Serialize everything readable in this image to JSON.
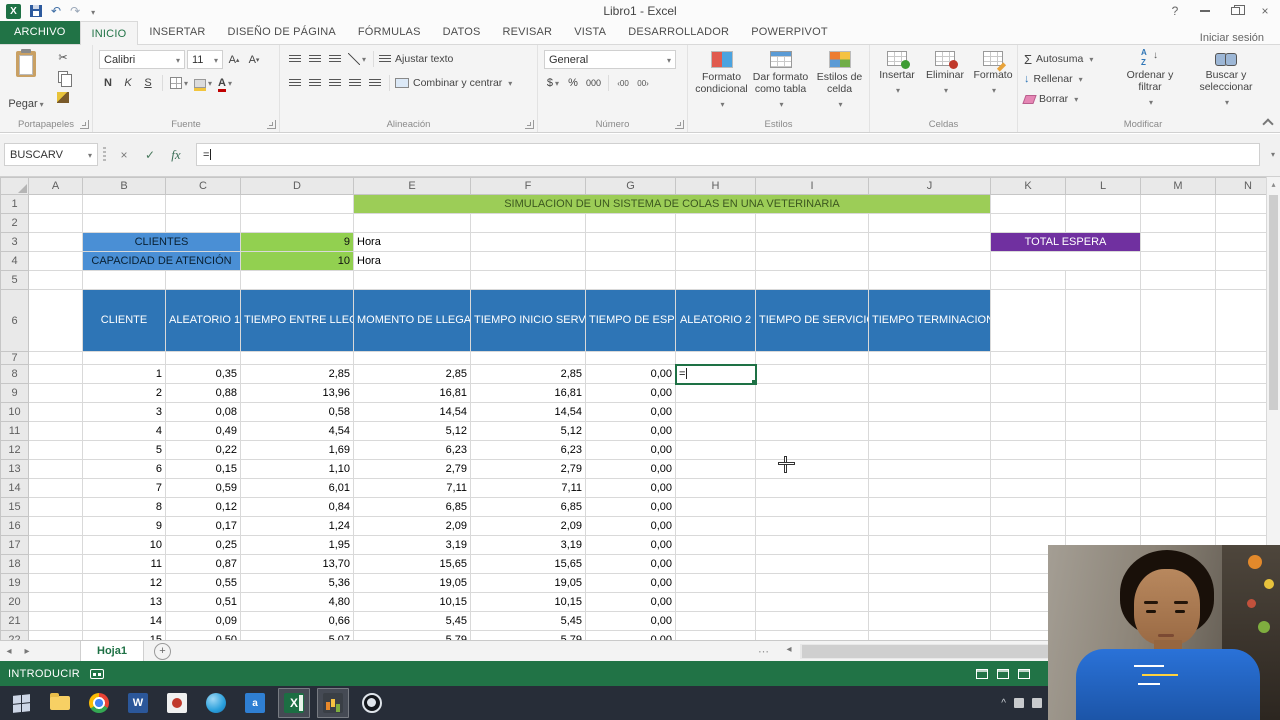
{
  "window": {
    "title": "Libro1 - Excel",
    "sign_in": "Iniciar sesión"
  },
  "icons": {
    "excel_logo_letter": "X",
    "undo": "↶",
    "redo": "↷",
    "help": "?",
    "close": "×",
    "check": "✓",
    "scissors": "✂",
    "letter_a": "A",
    "nav_left": "◂",
    "nav_right": "▸",
    "up": "▴",
    "down": "▾",
    "ellipsis": "⋯",
    "plus": "+",
    "fill_down_arrow": "↓",
    "sort_arrow": "↓",
    "word_letter": "W",
    "translator_letter": "a",
    "excel_letter": "X"
  },
  "ribbon_tabs": [
    {
      "label": "ARCHIVO"
    },
    {
      "label": "INICIO"
    },
    {
      "label": "INSERTAR"
    },
    {
      "label": "DISEÑO DE PÁGINA"
    },
    {
      "label": "FÓRMULAS"
    },
    {
      "label": "DATOS"
    },
    {
      "label": "REVISAR"
    },
    {
      "label": "VISTA"
    },
    {
      "label": "DESARROLLADOR"
    },
    {
      "label": "POWERPIVOT"
    }
  ],
  "ribbon": {
    "clipboard": {
      "group": "Portapapeles",
      "paste": "Pegar"
    },
    "font": {
      "group": "Fuente",
      "family": "Calibri",
      "size": "11",
      "bold": "N",
      "italic": "K",
      "underline": "S"
    },
    "alignment": {
      "group": "Alineación",
      "wrap": "Ajustar texto",
      "merge": "Combinar y centrar"
    },
    "number": {
      "group": "Número",
      "format": "General",
      "currency": "$",
      "percent": "%",
      "thousands": "000"
    },
    "styles": {
      "group": "Estilos",
      "conditional": "Formato condicional",
      "as_table": "Dar formato como tabla",
      "cell_styles": "Estilos de celda"
    },
    "cells": {
      "group": "Celdas",
      "insert": "Insertar",
      "delete": "Eliminar",
      "format": "Formato"
    },
    "editing": {
      "group": "Modificar",
      "autosum_symbol": "Σ",
      "autosum": "Autosuma",
      "fill": "Rellenar",
      "clear": "Borrar",
      "sort": "Ordenar y filtrar",
      "find": "Buscar y seleccionar"
    }
  },
  "formula_bar": {
    "name_box": "BUSCARV",
    "fx": "fx",
    "formula": "="
  },
  "sheet": {
    "columns": [
      "A",
      "B",
      "C",
      "D",
      "E",
      "F",
      "G",
      "H",
      "I",
      "J",
      "K",
      "L",
      "M",
      "N"
    ],
    "active_col": "H",
    "active_row": 8,
    "active_cell_text": "=",
    "banner": "SIMULACION DE UN SISTEMA DE COLAS EN UNA VETERINARIA",
    "params": [
      {
        "label": "CLIENTES",
        "value": "9",
        "unit": "Hora"
      },
      {
        "label": "CAPACIDAD DE ATENCIÓN",
        "value": "10",
        "unit": "Hora"
      }
    ],
    "total_header": "TOTAL ESPERA",
    "table_headers": [
      "CLIENTE",
      "ALEATORIO 1",
      "TIEMPO ENTRE LLEGADAS",
      "MOMENTO DE LLEGADA",
      "TIEMPO INICIO SERVICIO",
      "TIEMPO DE ESPERA",
      "ALEATORIO 2",
      "TIEMPO DE SERVICIO",
      "TIEMPO TERMINACION SERVICIO"
    ],
    "rows": [
      {
        "n": 8,
        "cells": [
          "1",
          "0,35",
          "2,85",
          "2,85",
          "2,85",
          "0,00"
        ]
      },
      {
        "n": 9,
        "cells": [
          "2",
          "0,88",
          "13,96",
          "16,81",
          "16,81",
          "0,00"
        ]
      },
      {
        "n": 10,
        "cells": [
          "3",
          "0,08",
          "0,58",
          "14,54",
          "14,54",
          "0,00"
        ]
      },
      {
        "n": 11,
        "cells": [
          "4",
          "0,49",
          "4,54",
          "5,12",
          "5,12",
          "0,00"
        ]
      },
      {
        "n": 12,
        "cells": [
          "5",
          "0,22",
          "1,69",
          "6,23",
          "6,23",
          "0,00"
        ]
      },
      {
        "n": 13,
        "cells": [
          "6",
          "0,15",
          "1,10",
          "2,79",
          "2,79",
          "0,00"
        ]
      },
      {
        "n": 14,
        "cells": [
          "7",
          "0,59",
          "6,01",
          "7,11",
          "7,11",
          "0,00"
        ]
      },
      {
        "n": 15,
        "cells": [
          "8",
          "0,12",
          "0,84",
          "6,85",
          "6,85",
          "0,00"
        ]
      },
      {
        "n": 16,
        "cells": [
          "9",
          "0,17",
          "1,24",
          "2,09",
          "2,09",
          "0,00"
        ]
      },
      {
        "n": 17,
        "cells": [
          "10",
          "0,25",
          "1,95",
          "3,19",
          "3,19",
          "0,00"
        ]
      },
      {
        "n": 18,
        "cells": [
          "11",
          "0,87",
          "13,70",
          "15,65",
          "15,65",
          "0,00"
        ]
      },
      {
        "n": 19,
        "cells": [
          "12",
          "0,55",
          "5,36",
          "19,05",
          "19,05",
          "0,00"
        ]
      },
      {
        "n": 20,
        "cells": [
          "13",
          "0,51",
          "4,80",
          "10,15",
          "10,15",
          "0,00"
        ]
      },
      {
        "n": 21,
        "cells": [
          "14",
          "0,09",
          "0,66",
          "5,45",
          "5,45",
          "0,00"
        ]
      }
    ],
    "partial_row": {
      "n": 22,
      "cells": [
        "15",
        "0,50",
        "5,07",
        "5,79",
        "5,79",
        "0,00"
      ]
    }
  },
  "sheet_tabs": {
    "tabs": [
      "Hoja1"
    ]
  },
  "status_bar": {
    "mode": "INTRODUCIR"
  }
}
